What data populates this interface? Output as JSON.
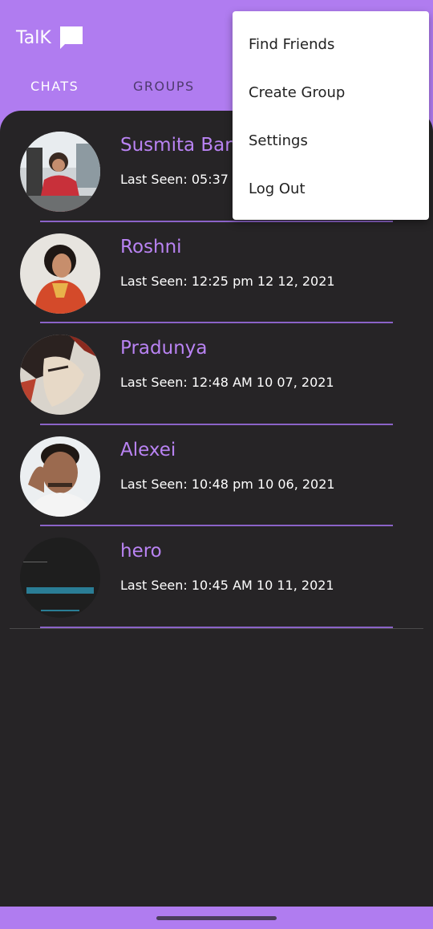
{
  "app": {
    "title": "TalK",
    "logo_icon": "chat-bubble-icon",
    "accent_color": "#b07cf0",
    "name_color": "#b983f3",
    "background_color": "#262426"
  },
  "tabs": [
    {
      "label": "CHATS",
      "active": true
    },
    {
      "label": "GROUPS",
      "active": false
    }
  ],
  "chats": [
    {
      "name": "Susmita Barr",
      "last_seen": "Last Seen: 05:37 P"
    },
    {
      "name": "Roshni",
      "last_seen": "Last Seen: 12:25 pm  12 12, 2021"
    },
    {
      "name": "Pradunya",
      "last_seen": "Last Seen: 12:48 AM  10 07, 2021"
    },
    {
      "name": "Alexei",
      "last_seen": "Last Seen: 10:48 pm  10 06, 2021"
    },
    {
      "name": "hero",
      "last_seen": "Last Seen: 10:45 AM  10 11, 2021"
    }
  ],
  "menu": {
    "items": [
      "Find Friends",
      "Create Group",
      "Settings",
      "Log Out"
    ]
  }
}
